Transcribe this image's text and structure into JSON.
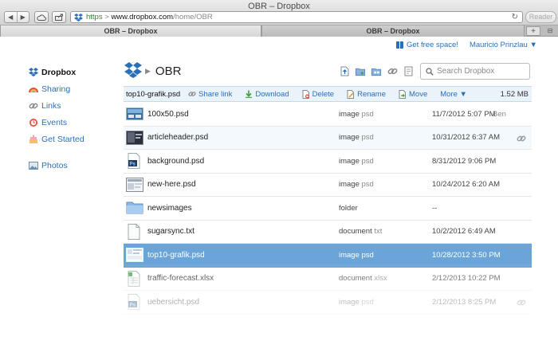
{
  "window": {
    "title": "OBR – Dropbox",
    "url_scheme": "https",
    "url_host": "www.dropbox.com",
    "url_path": "/home/OBR",
    "reader_label": "Reader"
  },
  "tabs": [
    {
      "label": "OBR – Dropbox",
      "active": true
    },
    {
      "label": "OBR – Dropbox",
      "active": false
    }
  ],
  "top_links": {
    "free_space": "Get free space!",
    "user": "Mauricio Prinzlau ▼"
  },
  "sidebar": {
    "items": [
      {
        "label": "Dropbox",
        "icon": "dropbox-icon"
      },
      {
        "label": "Sharing",
        "icon": "sharing-icon"
      },
      {
        "label": "Links",
        "icon": "links-icon"
      },
      {
        "label": "Events",
        "icon": "events-icon"
      },
      {
        "label": "Get Started",
        "icon": "get-started-icon"
      },
      {
        "label": "Photos",
        "icon": "photos-icon"
      }
    ]
  },
  "header": {
    "folder": "OBR",
    "search_placeholder": "Search Dropbox"
  },
  "actionbar": {
    "selected": "top10-grafik.psd",
    "share": "Share link",
    "download": "Download",
    "delete": "Delete",
    "rename": "Rename",
    "move": "Move",
    "more": "More ▼",
    "size": "1.52 MB"
  },
  "files": [
    {
      "name": "100x50.psd",
      "kind": "image",
      "ext": "psd",
      "modified": "11/7/2012 5:07 PM",
      "owner": "Ben",
      "thumb": "image-thumbnail-icon"
    },
    {
      "name": "articleheader.psd",
      "kind": "image",
      "ext": "psd",
      "modified": "10/31/2012 6:37 AM",
      "owner": "",
      "thumb": "image-thumbnail-icon"
    },
    {
      "name": "background.psd",
      "kind": "image",
      "ext": "psd",
      "modified": "8/31/2012 9:06 PM",
      "owner": "",
      "thumb": "psd-file-icon"
    },
    {
      "name": "new-here.psd",
      "kind": "image",
      "ext": "psd",
      "modified": "10/24/2012 6:20 AM",
      "owner": "",
      "thumb": "image-thumbnail-icon"
    },
    {
      "name": "newsimages",
      "kind": "folder",
      "ext": "",
      "modified": "--",
      "owner": "",
      "thumb": "folder-icon"
    },
    {
      "name": "sugarsync.txt",
      "kind": "document",
      "ext": "txt",
      "modified": "10/2/2012 6:49 AM",
      "owner": "",
      "thumb": "text-file-icon"
    },
    {
      "name": "top10-grafik.psd",
      "kind": "image",
      "ext": "psd",
      "modified": "10/28/2012 3:50 PM",
      "owner": "",
      "thumb": "image-thumbnail-icon"
    },
    {
      "name": "traffic-forecast.xlsx",
      "kind": "document",
      "ext": "xlsx",
      "modified": "2/12/2013 10:22 PM",
      "owner": "",
      "thumb": "spreadsheet-file-icon"
    },
    {
      "name": "uebersicht.psd",
      "kind": "image",
      "ext": "psd",
      "modified": "2/12/2013 8:25 PM",
      "owner": "",
      "thumb": "psd-file-icon"
    }
  ],
  "colors": {
    "link": "#2a70b8",
    "selected_row": "#6aa4d8",
    "action_bar": "#eaf2fa"
  }
}
